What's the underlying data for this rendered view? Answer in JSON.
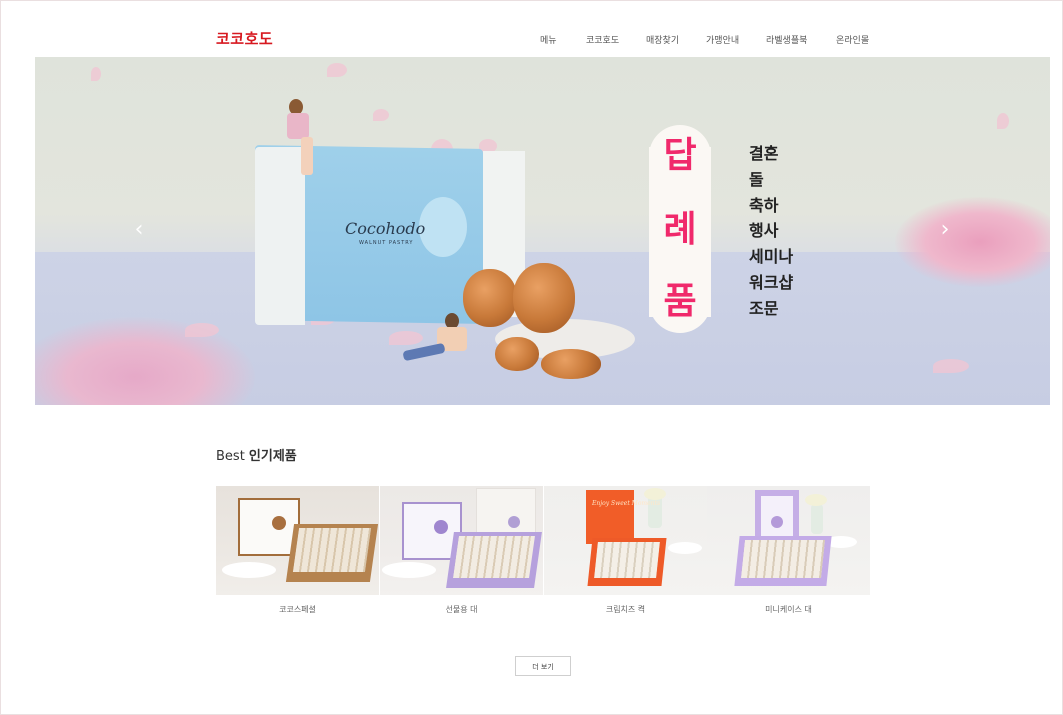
{
  "header": {
    "logo": "코코호도",
    "nav": [
      "메뉴",
      "코코호도",
      "매장찾기",
      "가맹안내",
      "라벨생플북",
      "온라인몰"
    ]
  },
  "hero": {
    "circle_chars": [
      "답",
      "례",
      "품"
    ],
    "list": [
      "결혼",
      "돌",
      "축하",
      "행사",
      "세미나",
      "워크샵",
      "조문"
    ],
    "bag_brand": "Cocohodo",
    "bag_brand_sub": "WALNUT PASTRY",
    "prev_arrow": "‹",
    "next_arrow": "›"
  },
  "best": {
    "title_light": "Best ",
    "title_strong": "인기제품",
    "products": [
      {
        "name": "코코스페셜"
      },
      {
        "name": "선물용 대"
      },
      {
        "name": "크림치즈 켝"
      },
      {
        "name": "미니케이스 대"
      }
    ],
    "product2_script": "Enjoy Sweet Moments",
    "more_label": "더 보기"
  },
  "colors": {
    "brand_red": "#d71920",
    "hero_accent_pink": "#f0296b",
    "hero_bag_blue": "#8ec5e6"
  },
  "icons": {
    "prev": "chevron-left-icon",
    "next": "chevron-right-icon"
  }
}
